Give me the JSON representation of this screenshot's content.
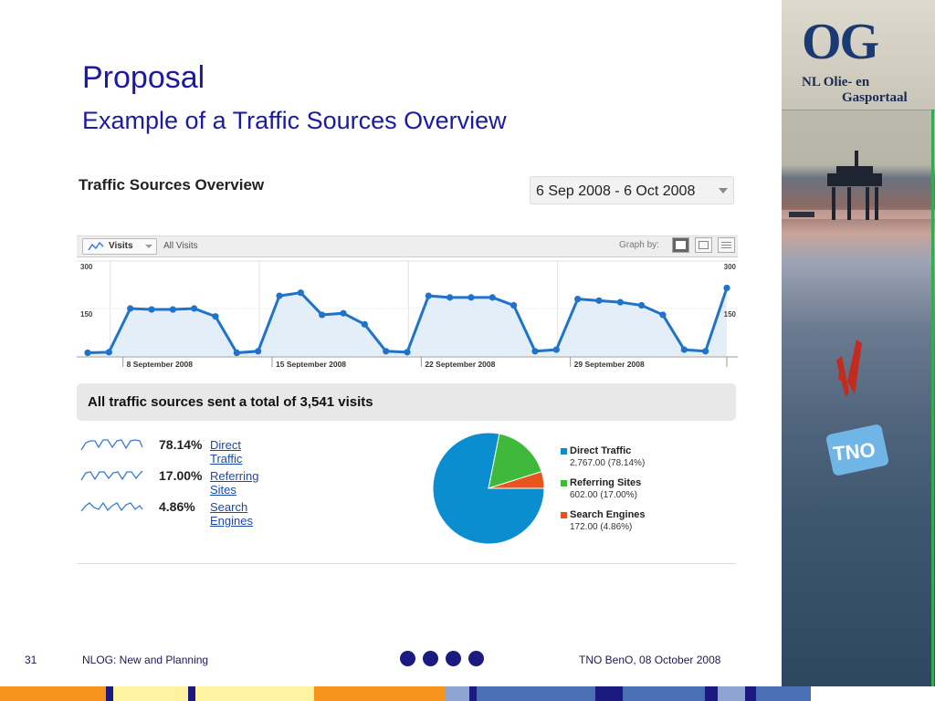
{
  "slide": {
    "title": "Proposal",
    "subtitle": "Example of a Traffic Sources Overview"
  },
  "logo": {
    "mark": "OG",
    "line1": "NL Olie- en",
    "line2": "Gasportaal"
  },
  "report": {
    "title": "Traffic Sources Overview",
    "date_range": "6 Sep 2008 - 6 Oct 2008",
    "metric_button": "Visits",
    "segment_label": "All Visits",
    "graph_by_label": "Graph by:"
  },
  "chart_data": {
    "type": "area",
    "series": [
      {
        "name": "Visits",
        "values": [
          10,
          12,
          150,
          147,
          147,
          150,
          125,
          10,
          15,
          190,
          200,
          130,
          135,
          100,
          15,
          12,
          190,
          185,
          185,
          185,
          160,
          15,
          20,
          180,
          175,
          170,
          160,
          130,
          20,
          15,
          215
        ]
      }
    ],
    "ylim": [
      0,
      300
    ],
    "ytick_labels": [
      "300",
      "150"
    ],
    "xtick_labels": [
      "8 September 2008",
      "15 September 2008",
      "22 September 2008",
      "29 September 2008"
    ],
    "grid": true
  },
  "summary": {
    "text": "All traffic sources sent a total of 3,541 visits"
  },
  "sources": [
    {
      "pct": "78.14%",
      "label": "Direct Traffic",
      "color": "#0b8ed0"
    },
    {
      "pct": "17.00%",
      "label": "Referring Sites",
      "color": "#3fb93c"
    },
    {
      "pct": "4.86%",
      "label": "Search Engines",
      "color": "#e8541e"
    }
  ],
  "pie": {
    "type": "pie",
    "slices": [
      {
        "name": "Direct Traffic",
        "value": 2767.0,
        "percent": 78.14,
        "value_label": "2,767.00 (78.14%)",
        "color": "#0b8ed0"
      },
      {
        "name": "Referring Sites",
        "value": 602.0,
        "percent": 17.0,
        "value_label": "602.00 (17.00%)",
        "color": "#3fb93c"
      },
      {
        "name": "Search Engines",
        "value": 172.0,
        "percent": 4.86,
        "value_label": "172.00 (4.86%)",
        "color": "#e8541e"
      }
    ]
  },
  "footer": {
    "page_number": "31",
    "left_text": "NLOG: New and Planning",
    "right_text": "TNO BenO, 08 October 2008"
  },
  "colors": {
    "title": "#1a1aa6",
    "accent_navy": "#1a1a80",
    "stripe_orange": "#f7941d",
    "stripe_yellow": "#fff2a0",
    "stripe_blue": "#4a6fb5"
  }
}
